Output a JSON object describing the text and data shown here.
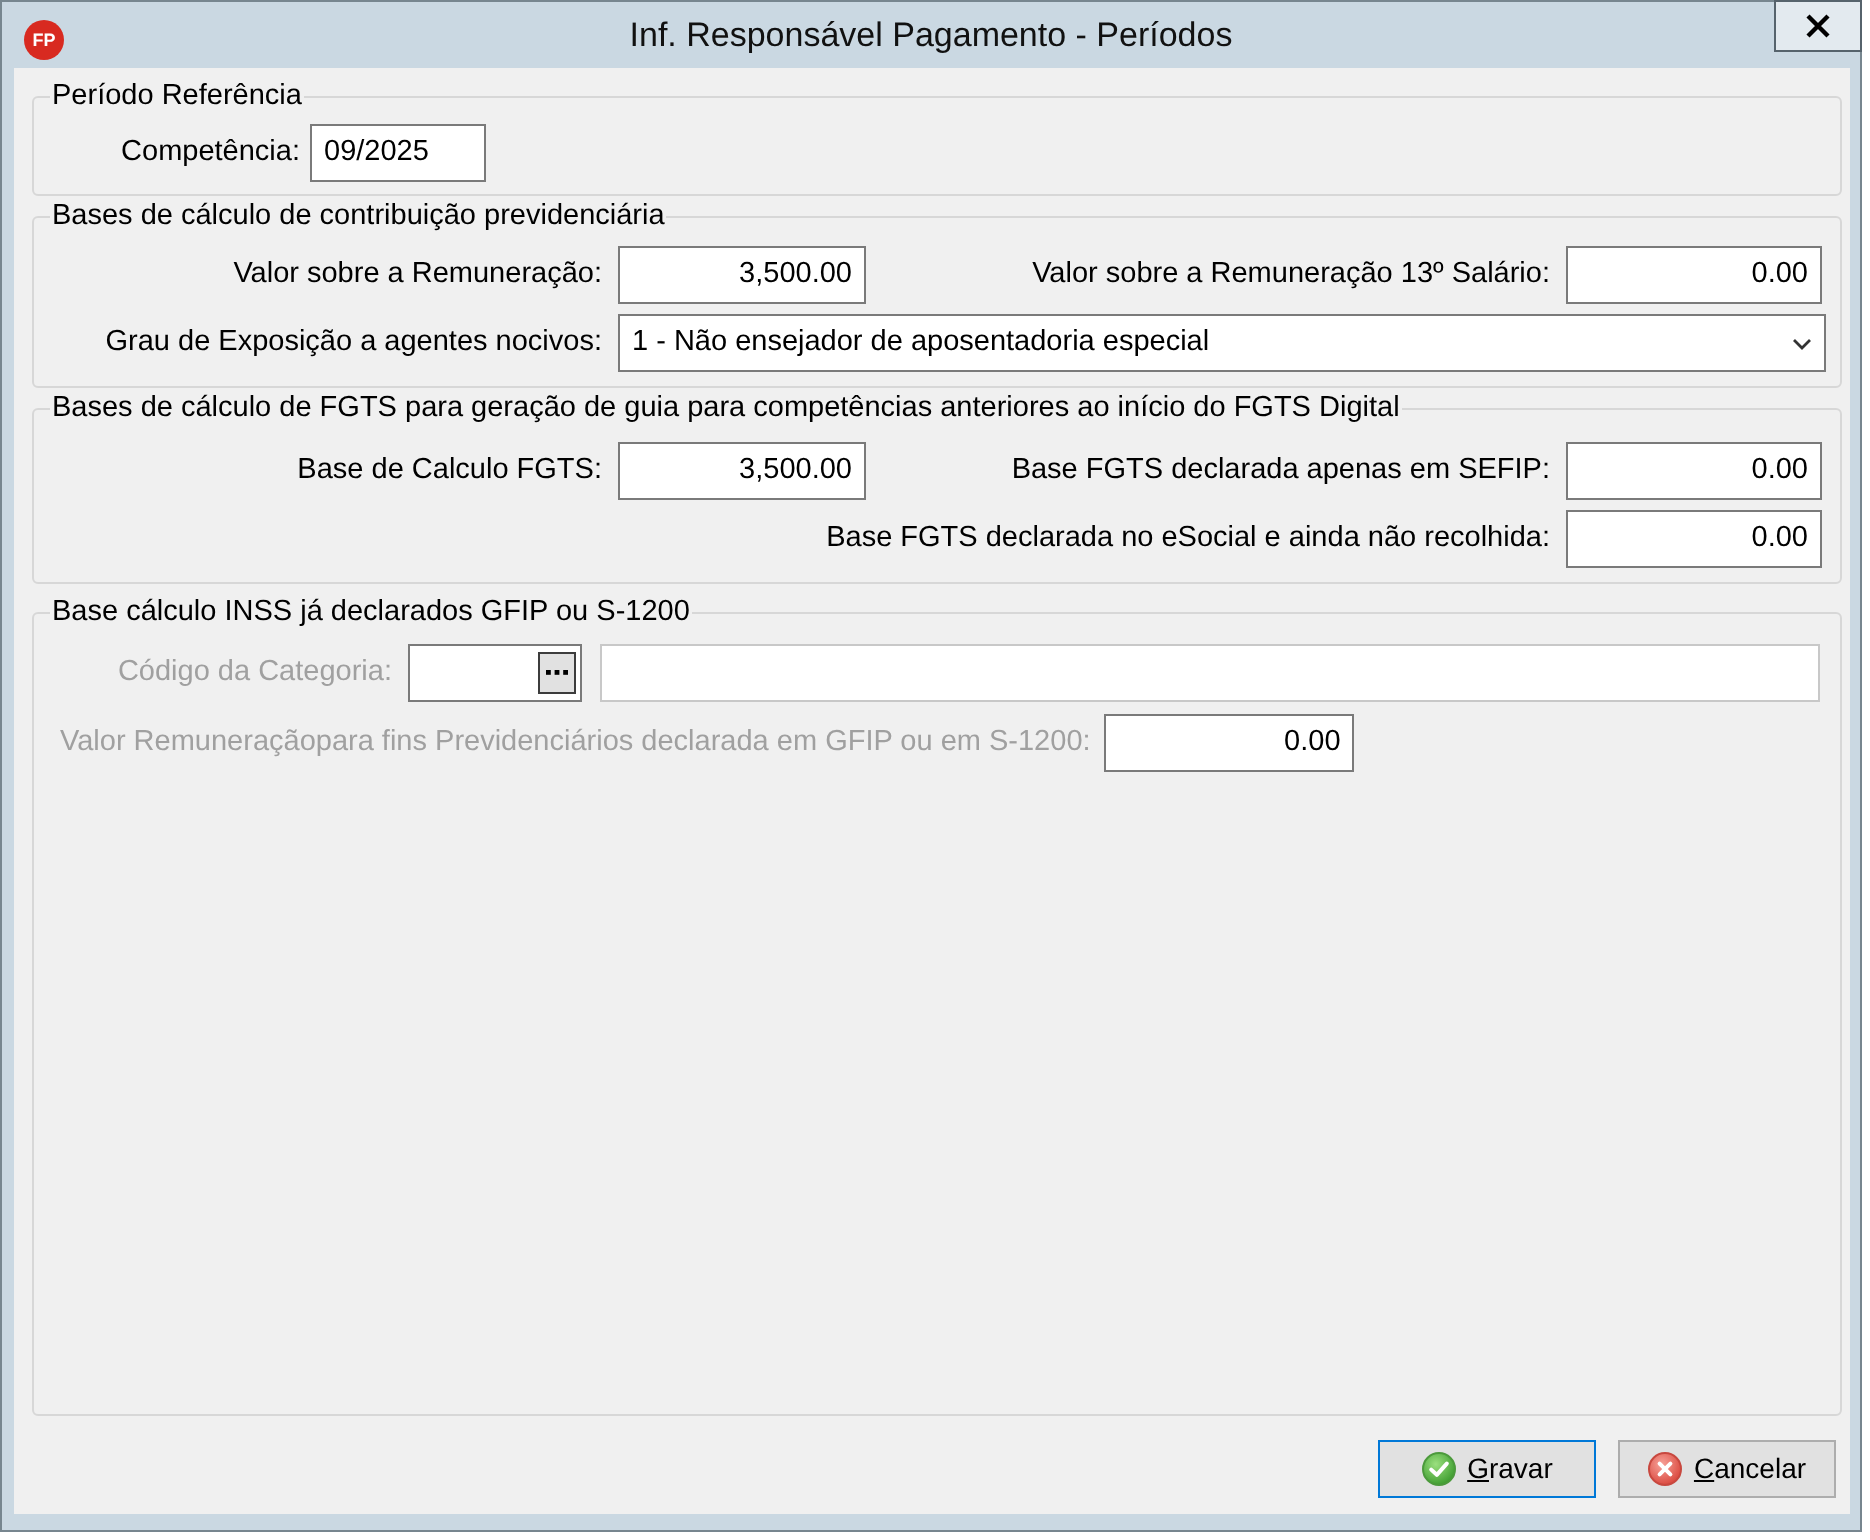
{
  "window": {
    "logo": "FP",
    "title": "Inf. Responsável Pagamento - Períodos"
  },
  "periodo": {
    "title": "Período Referência",
    "field": {
      "label": "Competência:",
      "value": "09/2025",
      "kind": "text"
    }
  },
  "previdenciaria": {
    "title": "Bases de cálculo de contribuição previdenciária",
    "rows": [
      {
        "left": {
          "label": "Valor sobre a Remuneração:",
          "value": "3,500.00",
          "kind": "number"
        },
        "right": {
          "label": "Valor sobre a Remuneração 13º Salário:",
          "value": "0.00",
          "kind": "number"
        }
      }
    ],
    "select": {
      "label": "Grau de Exposição a agentes nocivos:",
      "value": "1 - Não ensejador de aposentadoria especial"
    }
  },
  "fgts": {
    "title": "Bases de cálculo de FGTS para geração de guia para competências anteriores ao início do FGTS Digital",
    "rows": [
      {
        "left": {
          "label": "Base de Calculo FGTS:",
          "value": "3,500.00",
          "kind": "number"
        },
        "right": {
          "label": "Base FGTS declarada apenas em SEFIP:",
          "value": "0.00",
          "kind": "number"
        }
      },
      {
        "right": {
          "label": "Base FGTS declarada no eSocial e ainda não recolhida:",
          "value": "0.00",
          "kind": "number"
        }
      }
    ]
  },
  "inss": {
    "title": "Base cálculo INSS já declarados GFIP ou S-1200",
    "disabled": true,
    "categoria": {
      "label": "Código da Categoria:"
    },
    "valor": {
      "label": "Valor Remuneraçãopara fins Previdenciários declarada em GFIP ou em S-1200:",
      "value": "0.00",
      "kind": "number"
    }
  },
  "buttons": [
    {
      "label": "Gravar",
      "kind": "save",
      "mnemonic": true,
      "default": true
    },
    {
      "label": "Cancelar",
      "kind": "cancel",
      "mnemonic": true,
      "default": false
    }
  ]
}
